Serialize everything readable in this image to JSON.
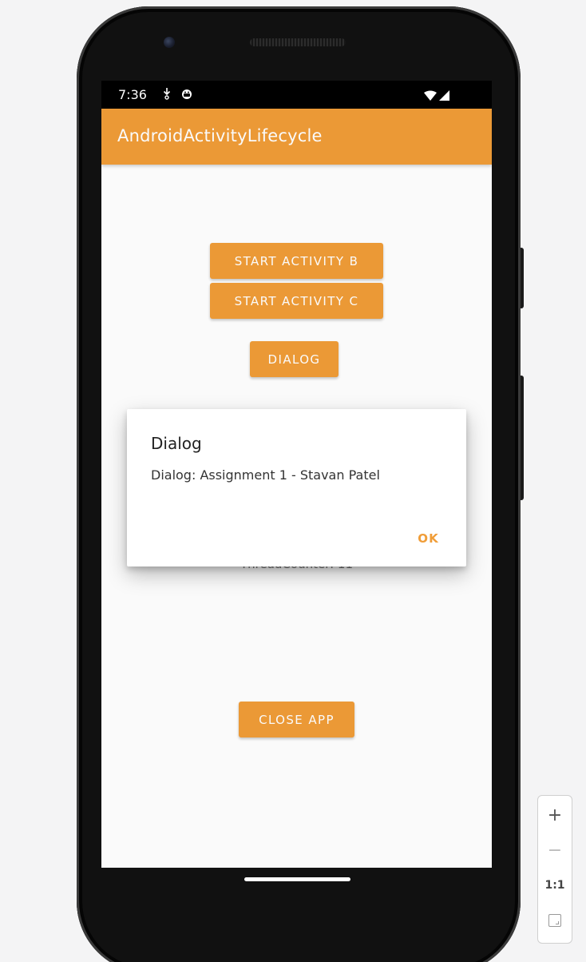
{
  "status_bar": {
    "time": "7:36",
    "icons": [
      "download-notification-icon",
      "android-notification-icon",
      "wifi-icon",
      "signal-icon"
    ]
  },
  "app_bar": {
    "title": "AndroidActivityLifecycle"
  },
  "buttons": {
    "start_b": "START ACTIVITY B",
    "start_c": "START ACTIVITY C",
    "dialog": "DIALOG",
    "close_app": "CLOSE APP"
  },
  "background_text": "ThreadCounter: 11",
  "dialog": {
    "title": "Dialog",
    "message": "Dialog: Assignment 1 - Stavan Patel",
    "ok_label": "OK"
  },
  "zoom_controls": {
    "zoom_in": "+",
    "zoom_out": "−",
    "actual_size": "1:1"
  },
  "colors": {
    "accent": "#f09d38",
    "screen_bg": "#ffffff",
    "status_bg": "#000000"
  }
}
